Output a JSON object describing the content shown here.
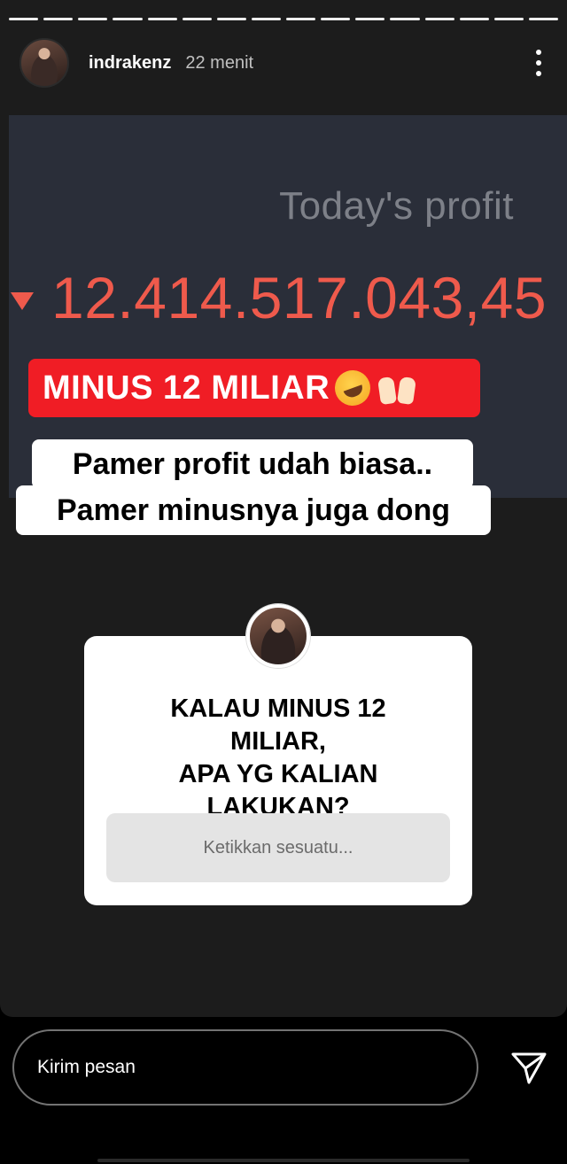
{
  "story": {
    "segments": 16,
    "username": "indrakenz",
    "time": "22 menit",
    "more_icon": "more-vertical-icon"
  },
  "screenshot": {
    "label": "Today's profit",
    "value": "12.414.517.043,45",
    "direction_icon": "triangle-down-icon",
    "value_color": "#ef5a4c"
  },
  "captions": {
    "minus_tag": "MINUS 12 MILIAR",
    "line1": "Pamer profit udah biasa..",
    "line2": "Pamer minusnya juga dong",
    "tag_color": "#f01d25"
  },
  "question": {
    "text": "KALAU MINUS 12 MILIAR,\nAPA YG KALIAN\nLAKUKAN?",
    "placeholder": "Ketikkan sesuatu..."
  },
  "footer": {
    "message_placeholder": "Kirim pesan",
    "send_icon": "send-icon"
  }
}
